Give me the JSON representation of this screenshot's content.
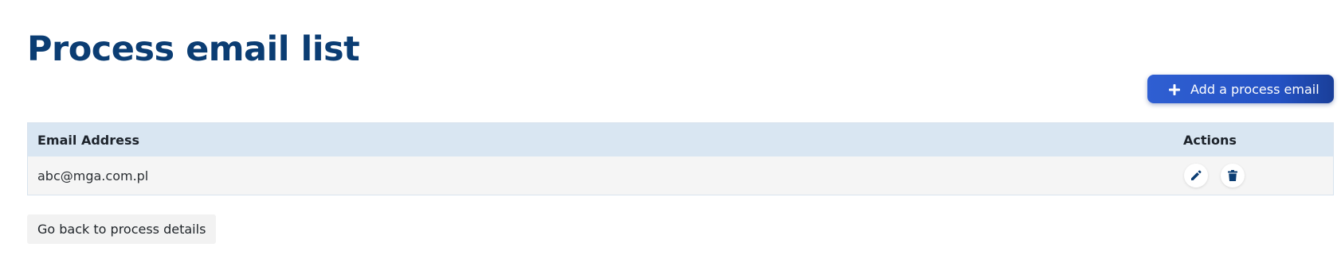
{
  "page": {
    "title": "Process email list"
  },
  "toolbar": {
    "add_label": "Add a process email",
    "add_icon": "plus-icon",
    "accent_color": "#2452c4"
  },
  "table": {
    "columns": [
      "Email Address",
      "Actions"
    ],
    "header_color": "#d9e6f2",
    "rows": [
      {
        "email": "abc@mga.com.pl",
        "actions": [
          "edit-pencil-icon",
          "delete-trash-icon"
        ]
      }
    ]
  },
  "footer": {
    "back_label": "Go back to process details"
  },
  "colors": {
    "title": "#0b3d73",
    "icon": "#0b3d73"
  }
}
